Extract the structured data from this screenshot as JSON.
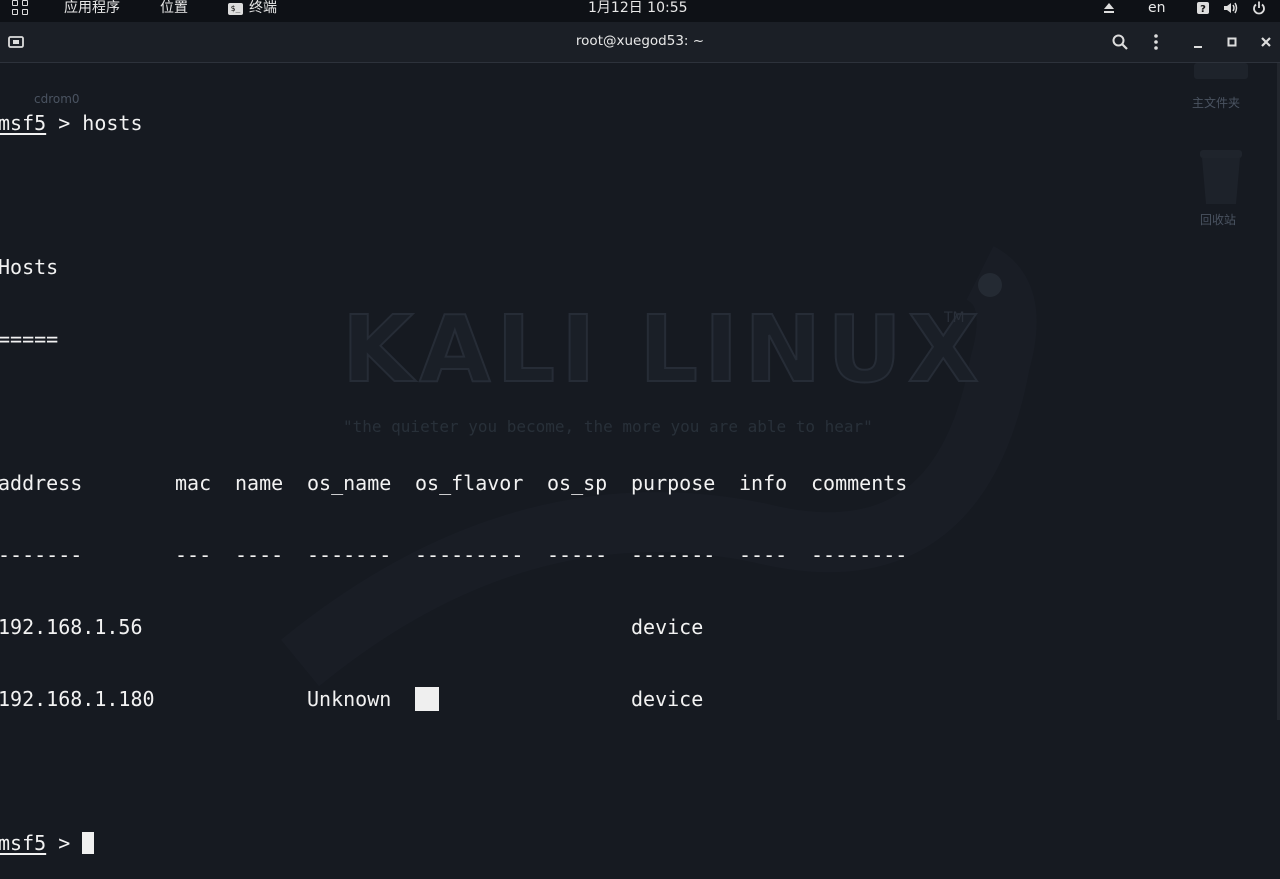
{
  "topbar": {
    "applications_label": "应用程序",
    "places_label": "位置",
    "terminal_label": "终端",
    "clock": "1月12日  10:55",
    "lang": "en"
  },
  "headerbar": {
    "title": "root@xuegod53: ~"
  },
  "desktop": {
    "icon1_label": "cdrom0",
    "icon2_label": "主文件夹",
    "icon3_label": "回收站",
    "logo_text": "KALI LINUX",
    "logo_tm": "TM",
    "tagline": "\"the quieter you become, the more you are able to hear\""
  },
  "terminal": {
    "prompt_label": "msf5",
    "prompt_symbol": " > ",
    "command": "hosts",
    "section_title": "Hosts",
    "section_underline": "=====",
    "columns": [
      "address",
      "mac",
      "name",
      "os_name",
      "os_flavor",
      "os_sp",
      "purpose",
      "info",
      "comments"
    ],
    "column_dashes": [
      "-------",
      "---",
      "----",
      "-------",
      "---------",
      "-----",
      "-------",
      "----",
      "--------"
    ],
    "rows": [
      {
        "address": "192.168.1.56",
        "mac": "",
        "name": "",
        "os_name": "",
        "os_flavor": "",
        "os_sp": "",
        "purpose": "device",
        "info": "",
        "comments": ""
      },
      {
        "address": "192.168.1.180",
        "mac": "",
        "name": "",
        "os_name": "Unknown",
        "os_flavor": "",
        "os_sp": "",
        "purpose": "device",
        "info": "",
        "comments": ""
      }
    ]
  }
}
